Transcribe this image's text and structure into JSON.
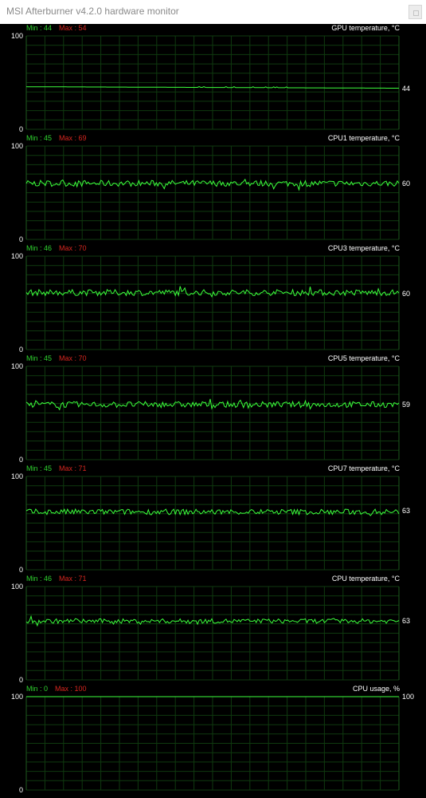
{
  "window": {
    "title": "MSI Afterburner v4.2.0 hardware monitor"
  },
  "graphs": [
    {
      "title": "GPU temperature, °C",
      "min_label": "Min : 44",
      "max_label": "Max : 54",
      "y_max": "100",
      "y_min": "0",
      "current_label": "44",
      "current": 44,
      "range": [
        0,
        100
      ],
      "style": "gpu",
      "base": 44,
      "noise": 0
    },
    {
      "title": "CPU1 temperature, °C",
      "min_label": "Min : 45",
      "max_label": "Max : 69",
      "y_max": "100",
      "y_min": "0",
      "current_label": "60",
      "current": 60,
      "range": [
        0,
        100
      ],
      "style": "noisy",
      "base": 60,
      "noise": 3.2
    },
    {
      "title": "CPU3 temperature, °C",
      "min_label": "Min : 46",
      "max_label": "Max : 70",
      "y_max": "100",
      "y_min": "0",
      "current_label": "60",
      "current": 60,
      "range": [
        0,
        100
      ],
      "style": "noisy",
      "base": 61,
      "noise": 3.2
    },
    {
      "title": "CPU5 temperature, °C",
      "min_label": "Min : 45",
      "max_label": "Max : 70",
      "y_max": "100",
      "y_min": "0",
      "current_label": "59",
      "current": 59,
      "range": [
        0,
        100
      ],
      "style": "noisy",
      "base": 59,
      "noise": 3.2
    },
    {
      "title": "CPU7 temperature, °C",
      "min_label": "Min : 45",
      "max_label": "Max : 71",
      "y_max": "100",
      "y_min": "0",
      "current_label": "63",
      "current": 63,
      "range": [
        0,
        100
      ],
      "style": "noisy",
      "base": 62,
      "noise": 3.0
    },
    {
      "title": "CPU temperature, °C",
      "min_label": "Min : 46",
      "max_label": "Max : 71",
      "y_max": "100",
      "y_min": "0",
      "current_label": "63",
      "current": 63,
      "range": [
        0,
        100
      ],
      "style": "noisy",
      "base": 63,
      "noise": 2.4
    },
    {
      "title": "CPU usage, %",
      "min_label": "Min : 0",
      "max_label": "Max : 100",
      "y_max": "100",
      "y_min": "0",
      "current_label": "100",
      "current": 100,
      "range": [
        0,
        100
      ],
      "style": "flat",
      "base": 100,
      "noise": 0
    }
  ],
  "colors": {
    "background": "#000000",
    "grid": "#0f3a0f",
    "axis": "#1e5a1e",
    "trace": "#3cff3c",
    "min_label": "#2fd52f",
    "max_label": "#d8261f",
    "text": "#ffffff"
  }
}
